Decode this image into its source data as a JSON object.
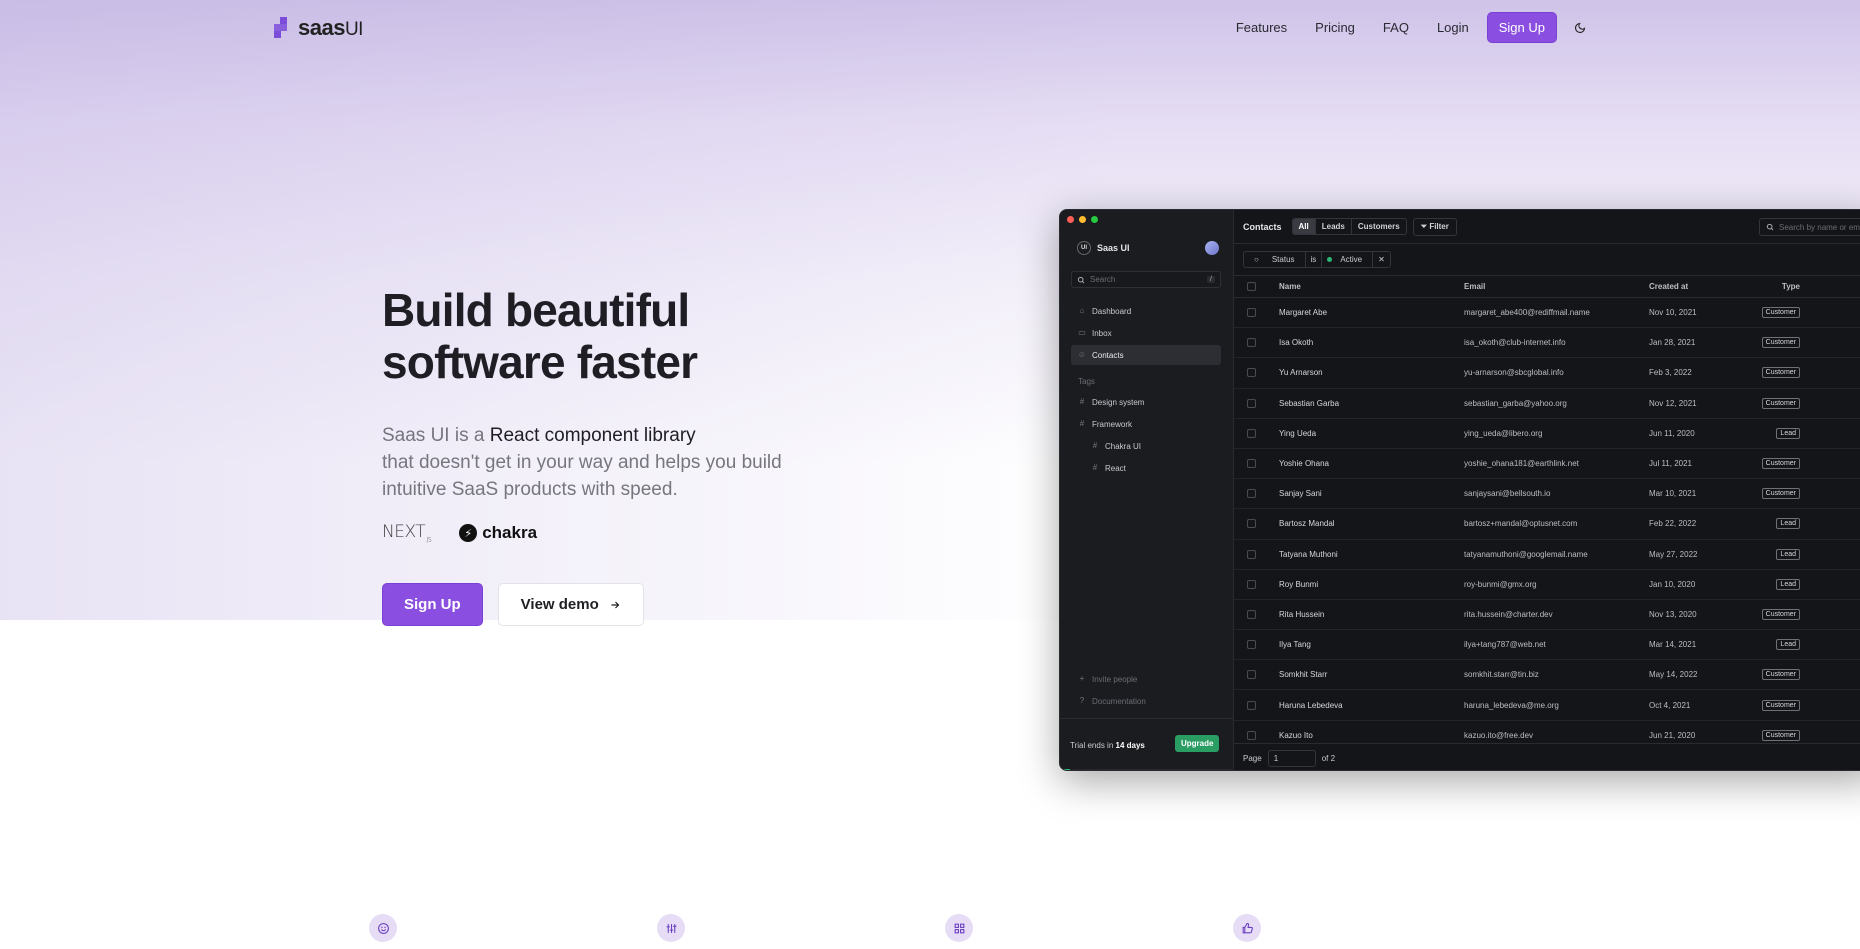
{
  "colors": {
    "brand": "#8a4fe0",
    "upgrade": "#2a9d63",
    "active_dot": "#2ab673"
  },
  "header": {
    "logo_text": "saas",
    "logo_suffix": "UI",
    "nav": [
      "Features",
      "Pricing",
      "FAQ",
      "Login"
    ],
    "signup_label": "Sign Up",
    "theme_icon": "moon-icon"
  },
  "hero": {
    "title_line1": "Build beautiful",
    "title_line2": "software faster",
    "desc_prefix": "Saas UI is a ",
    "desc_highlight": "React component library",
    "desc_rest": "that doesn't get in your way and helps you build intuitive SaaS products with speed.",
    "logos": {
      "next": "NEXT",
      "next_suffix": ".JS",
      "chakra": "chakra"
    },
    "primary_label": "Sign Up",
    "secondary_label": "View demo"
  },
  "app": {
    "sidebar": {
      "workspace": "Saas UI",
      "badge": "UI",
      "search_placeholder": "Search",
      "search_kbd": "/",
      "nav": [
        "Dashboard",
        "Inbox",
        "Contacts"
      ],
      "tags_label": "Tags",
      "tags": [
        "Design system",
        "Framework",
        "Chakra UI",
        "React"
      ],
      "bottom": [
        "Invite people",
        "Documentation"
      ],
      "trial_prefix": "Trial ends in ",
      "trial_days": "14 days",
      "upgrade_label": "Upgrade",
      "trial_progress": 0.06
    },
    "toolbar": {
      "title": "Contacts",
      "segments": [
        "All",
        "Leads",
        "Customers"
      ],
      "filter_label": "Filter",
      "search_placeholder": "Search by name or email..."
    },
    "filter_chip": {
      "field": "Status",
      "op": "is",
      "value": "Active"
    },
    "columns": [
      "Name",
      "Email",
      "Created at",
      "Type"
    ],
    "rows": [
      [
        "Margaret Abe",
        "margaret_abe400@rediffmail.name",
        "Nov 10, 2021",
        "Customer"
      ],
      [
        "Isa Okoth",
        "isa_okoth@club-internet.info",
        "Jan 28, 2021",
        "Customer"
      ],
      [
        "Yu Arnarson",
        "yu-arnarson@sbcglobal.info",
        "Feb 3, 2022",
        "Customer"
      ],
      [
        "Sebastian Garba",
        "sebastian_garba@yahoo.org",
        "Nov 12, 2021",
        "Customer"
      ],
      [
        "Ying Ueda",
        "ying_ueda@libero.org",
        "Jun 11, 2020",
        "Lead"
      ],
      [
        "Yoshie Ohana",
        "yoshie_ohana181@earthlink.net",
        "Jul 11, 2021",
        "Customer"
      ],
      [
        "Sanjay Sani",
        "sanjaysani@bellsouth.io",
        "Mar 10, 2021",
        "Customer"
      ],
      [
        "Bartosz Mandal",
        "bartosz+mandal@optusnet.com",
        "Feb 22, 2022",
        "Lead"
      ],
      [
        "Tatyana Muthoni",
        "tatyanamuthoni@googlemail.name",
        "May 27, 2022",
        "Lead"
      ],
      [
        "Roy Bunmi",
        "roy-bunmi@gmx.org",
        "Jan 10, 2020",
        "Lead"
      ],
      [
        "Rita Hussein",
        "rita.hussein@charter.dev",
        "Nov 13, 2020",
        "Customer"
      ],
      [
        "Ilya Tang",
        "ilya+tang787@web.net",
        "Mar 14, 2021",
        "Lead"
      ],
      [
        "Somkhit Starr",
        "somkhit.starr@tin.biz",
        "May 14, 2022",
        "Customer"
      ],
      [
        "Haruna Lebedeva",
        "haruna_lebedeva@me.org",
        "Oct 4, 2021",
        "Customer"
      ],
      [
        "Kazuo Ito",
        "kazuo.ito@free.dev",
        "Jun 21, 2020",
        "Customer"
      ]
    ],
    "pager": {
      "label": "Page",
      "current": "1",
      "total": "of 2"
    }
  },
  "features_icons": [
    "smile-icon",
    "sliders-icon",
    "grid-icon",
    "thumbs-up-icon"
  ]
}
